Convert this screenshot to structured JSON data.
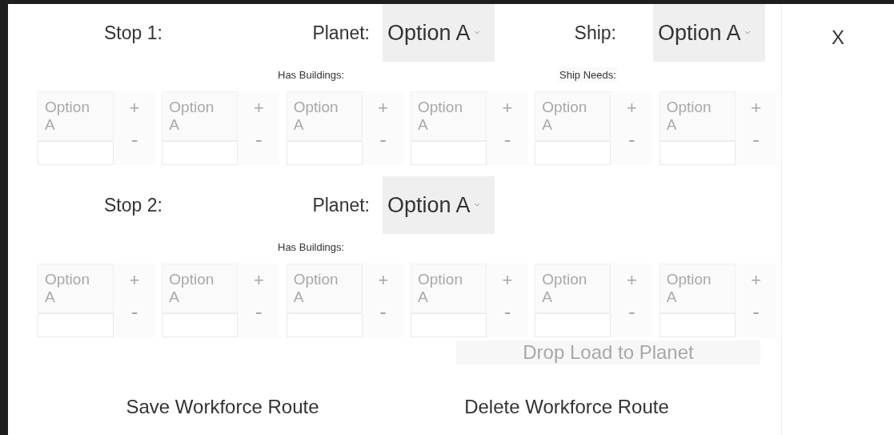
{
  "close_button": "X",
  "stops": [
    {
      "label": "Stop 1:",
      "planet_label": "Planet:",
      "planet": "Option A",
      "ship_label": "Ship:",
      "ship": "Option A",
      "buildings_label": "Has Buildings:",
      "needs_label": "Ship Needs:",
      "slots": [
        {
          "option": "Option A",
          "plus": "+",
          "minus": "-"
        },
        {
          "option": "Option A",
          "plus": "+",
          "minus": "-"
        },
        {
          "option": "Option A",
          "plus": "+",
          "minus": "-"
        },
        {
          "option": "Option A",
          "plus": "+",
          "minus": "-"
        },
        {
          "option": "Option A",
          "plus": "+",
          "minus": "-"
        },
        {
          "option": "Option A",
          "plus": "+",
          "minus": "-"
        }
      ]
    },
    {
      "label": "Stop 2:",
      "planet_label": "Planet:",
      "planet": "Option A",
      "buildings_label": "Has Buildings:",
      "slots": [
        {
          "option": "Option A",
          "plus": "+",
          "minus": "-"
        },
        {
          "option": "Option A",
          "plus": "+",
          "minus": "-"
        },
        {
          "option": "Option A",
          "plus": "+",
          "minus": "-"
        },
        {
          "option": "Option A",
          "plus": "+",
          "minus": "-"
        },
        {
          "option": "Option A",
          "plus": "+",
          "minus": "-"
        },
        {
          "option": "Option A",
          "plus": "+",
          "minus": "-"
        }
      ]
    }
  ],
  "background_button": "Drop Load to Planet",
  "buttons": [
    "Save Workforce Route",
    "Delete Workforce Route"
  ]
}
